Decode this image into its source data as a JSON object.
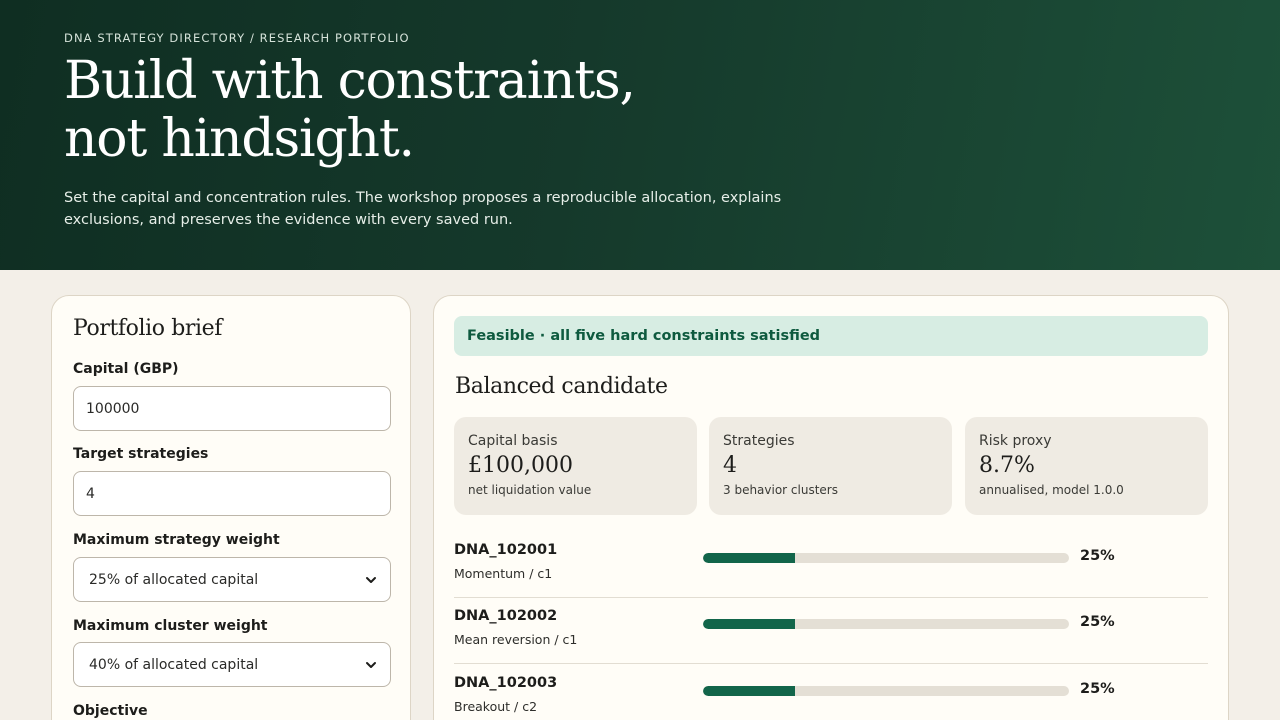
{
  "hero": {
    "eyebrow": "DNA STRATEGY DIRECTORY / RESEARCH PORTFOLIO",
    "title_line1": "Build with constraints,",
    "title_line2": "not hindsight.",
    "description": "Set the capital and concentration rules. The workshop proposes a reproducible allocation, explains exclusions, and preserves the evidence with every saved run."
  },
  "brief": {
    "title": "Portfolio brief",
    "fields": [
      {
        "label": "Capital (GBP)",
        "value": "100000",
        "type": "input"
      },
      {
        "label": "Target strategies",
        "value": "4",
        "type": "input"
      },
      {
        "label": "Maximum strategy weight",
        "value": "25% of allocated capital",
        "type": "select"
      },
      {
        "label": "Maximum cluster weight",
        "value": "40% of allocated capital",
        "type": "select"
      }
    ],
    "objective_label": "Objective"
  },
  "results": {
    "status": "Feasible · all five hard constraints satisfied",
    "candidate_title": "Balanced candidate",
    "stats": [
      {
        "label": "Capital basis",
        "value": "£100,000",
        "sub": "net liquidation value"
      },
      {
        "label": "Strategies",
        "value": "4",
        "sub": "3 behavior clusters"
      },
      {
        "label": "Risk proxy",
        "value": "8.7%",
        "sub": "annualised, model 1.0.0"
      }
    ],
    "allocations": [
      {
        "id": "DNA_102001",
        "sub": "Momentum / c1",
        "weight": 0.25,
        "pct": "25%"
      },
      {
        "id": "DNA_102002",
        "sub": "Mean reversion / c1",
        "weight": 0.25,
        "pct": "25%"
      },
      {
        "id": "DNA_102003",
        "sub": "Breakout / c2",
        "weight": 0.25,
        "pct": "25%"
      }
    ]
  },
  "colors": {
    "hero_start": "#0f2e22",
    "hero_end": "#1d5039",
    "accent": "#12654a",
    "status_bg": "#d7ede3",
    "page_bg": "#f3efe8"
  }
}
